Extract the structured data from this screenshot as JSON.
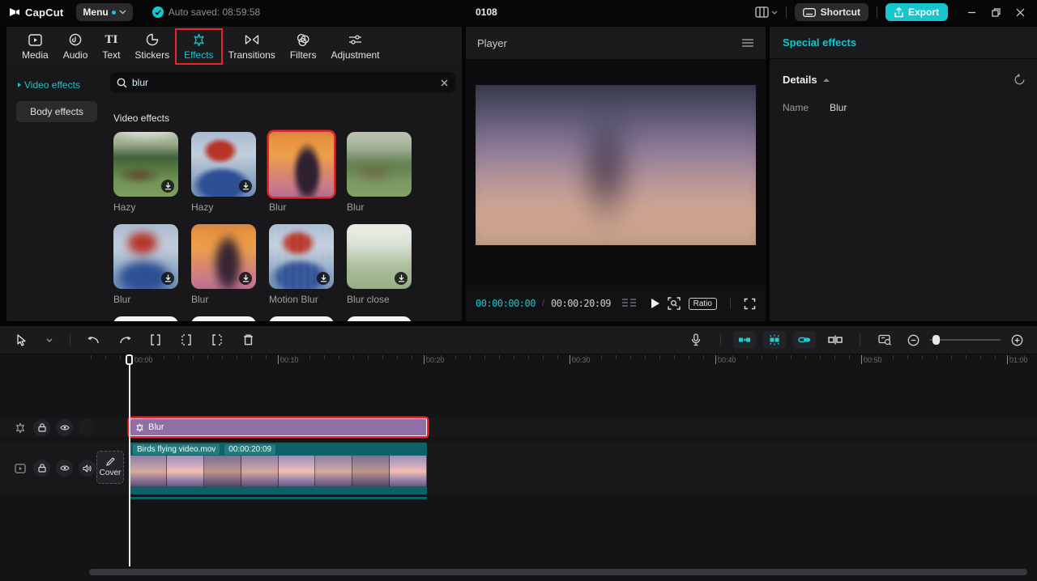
{
  "topbar": {
    "logo_text": "CapCut",
    "menu_label": "Menu",
    "autosave_text": "Auto saved: 08:59:58",
    "project_title": "0108",
    "shortcut_label": "Shortcut",
    "export_label": "Export"
  },
  "tabs": [
    {
      "label": "Media"
    },
    {
      "label": "Audio"
    },
    {
      "label": "Text"
    },
    {
      "label": "Stickers"
    },
    {
      "label": "Effects",
      "active": true
    },
    {
      "label": "Transitions"
    },
    {
      "label": "Filters"
    },
    {
      "label": "Adjustment"
    }
  ],
  "sidebar": {
    "items": [
      {
        "label": "Video effects",
        "active": true
      },
      {
        "label": "Body effects",
        "active": false
      }
    ]
  },
  "search": {
    "query": "blur"
  },
  "effects_panel": {
    "section_title": "Video effects",
    "items": [
      {
        "name": "Hazy",
        "downloadable": true,
        "selected": false
      },
      {
        "name": "Hazy",
        "downloadable": true,
        "selected": false
      },
      {
        "name": "Blur",
        "downloadable": false,
        "selected": true
      },
      {
        "name": "Blur",
        "downloadable": false,
        "selected": false
      },
      {
        "name": "Blur",
        "downloadable": true,
        "selected": false
      },
      {
        "name": "Blur",
        "downloadable": true,
        "selected": false
      },
      {
        "name": "Motion Blur",
        "downloadable": true,
        "selected": false
      },
      {
        "name": "Blur close",
        "downloadable": true,
        "selected": false
      }
    ]
  },
  "player": {
    "title": "Player",
    "current_time": "00:00:00:00",
    "timecode_separator": "/",
    "duration": "00:00:20:09",
    "ratio_label": "Ratio"
  },
  "inspector": {
    "tab_title": "Special effects",
    "section_title": "Details",
    "fields": [
      {
        "label": "Name",
        "value": "Blur"
      }
    ]
  },
  "timeline": {
    "ruler_labels": [
      "00:00",
      "00:10",
      "00:20",
      "00:30",
      "00:40",
      "00:50",
      "01:00"
    ],
    "tracks": {
      "effect_clip_label": "Blur",
      "video_clip_name": "Birds flying video.mov",
      "video_clip_duration": "00:00:20:09",
      "cover_label": "Cover"
    }
  },
  "icons": {
    "text_tab_glyph": "TI"
  },
  "colors": {
    "accent_teal": "#17c6ce",
    "selection_red": "#e8252a",
    "effect_clip_purple": "#8f6fa5",
    "video_clip_teal": "#0e6166"
  }
}
